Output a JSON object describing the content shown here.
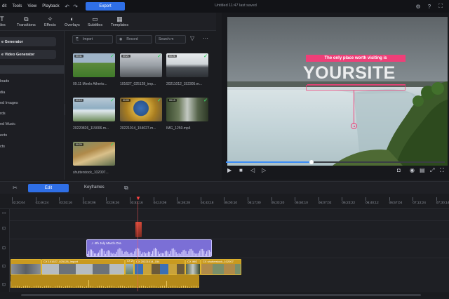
{
  "menubar": {
    "items": [
      "dit",
      "Tools",
      "View",
      "Playback"
    ],
    "export_label": "Export",
    "project_title": "Untitled  11:47  last saved"
  },
  "toolbar": {
    "tabs": [
      {
        "label": "itles",
        "icon": "text-icon"
      },
      {
        "label": "Transitions",
        "icon": "transitions-icon"
      },
      {
        "label": "Effects",
        "icon": "effects-icon"
      },
      {
        "label": "Overlays",
        "icon": "overlays-icon"
      },
      {
        "label": "Subtitles",
        "icon": "subtitles-icon"
      },
      {
        "label": "Templates",
        "icon": "templates-icon"
      }
    ]
  },
  "sidebar": {
    "generators": [
      "e Generator",
      "e Video Generator"
    ],
    "items": [
      "",
      "loads",
      "dia",
      "nd Images",
      "rds",
      "nd Music",
      "ects",
      "cts",
      ""
    ]
  },
  "media": {
    "import_label": "Import",
    "record_label": "Record",
    "search_placeholder": "Search m",
    "items": [
      {
        "name": "09.11 Menlo Atherto...",
        "duration": "00:41"
      },
      {
        "name": "101627_025128_imp...",
        "duration": "00:21"
      },
      {
        "name": "20211012_152305.m...",
        "duration": "00:26"
      },
      {
        "name": "20220826_115006.m...",
        "duration": "00:13"
      },
      {
        "name": "20221014_154027.m...",
        "duration": "00:09"
      },
      {
        "name": "IMG_1250.mp4",
        "duration": "00:13"
      },
      {
        "name": "shutterstock_102007...",
        "duration": "00:29"
      }
    ]
  },
  "preview": {
    "banner_text": "The only place worth visiting is",
    "headline": "YOURSITE",
    "progress": 0.39
  },
  "timeline": {
    "edit_label": "Edit",
    "keyframes_label": "Keyframes",
    "ticks": [
      "02;30;04",
      "02;46;24",
      "03;03;16",
      "03;20;06",
      "03;36;26",
      "03;53;16",
      "04;10;08",
      "04;26;28",
      "04;43;18",
      "05;00;10",
      "05;17;00",
      "05;33;20",
      "05;50;10",
      "06;07;02",
      "06;23;22",
      "06;40;12",
      "06;57;04",
      "07;13;24",
      "07;30;14"
    ],
    "audio_clip_label": "4th July March.Ora",
    "video_clips": [
      {
        "label": "CX  101627_025128_import"
      },
      {
        "label": "CX  2022"
      },
      {
        "label": "CX  20221014_154"
      },
      {
        "label": "CX  IMG"
      },
      {
        "label": "CX  shutterstock_102007"
      }
    ]
  }
}
